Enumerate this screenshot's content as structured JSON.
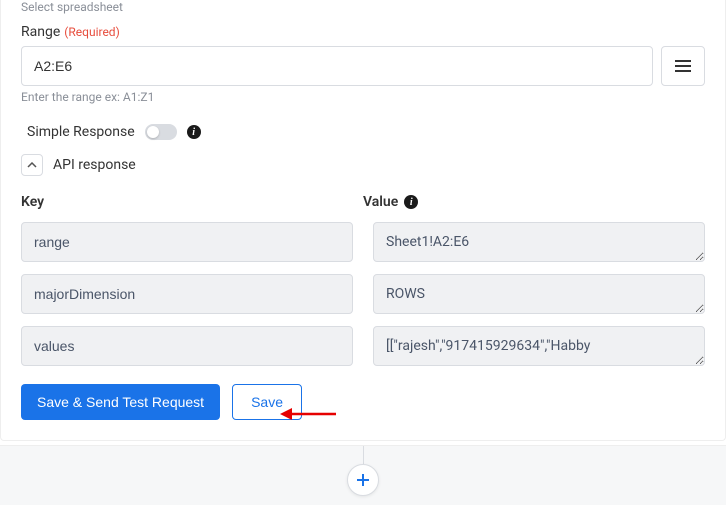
{
  "spreadsheet_label": "Select spreadsheet",
  "range": {
    "label": "Range",
    "required_text": "(Required)",
    "value": "A2:E6",
    "helper": "Enter the range ex: A1:Z1"
  },
  "simple_response": {
    "label": "Simple Response",
    "on": false
  },
  "api_response": {
    "label": "API response",
    "key_header": "Key",
    "value_header": "Value",
    "rows": [
      {
        "key": "range",
        "value": "Sheet1!A2:E6"
      },
      {
        "key": "majorDimension",
        "value": "ROWS"
      },
      {
        "key": "values",
        "value": "[[\"rajesh\",\"917415929634\",\"Habby"
      }
    ]
  },
  "buttons": {
    "primary": "Save & Send Test Request",
    "secondary": "Save"
  }
}
